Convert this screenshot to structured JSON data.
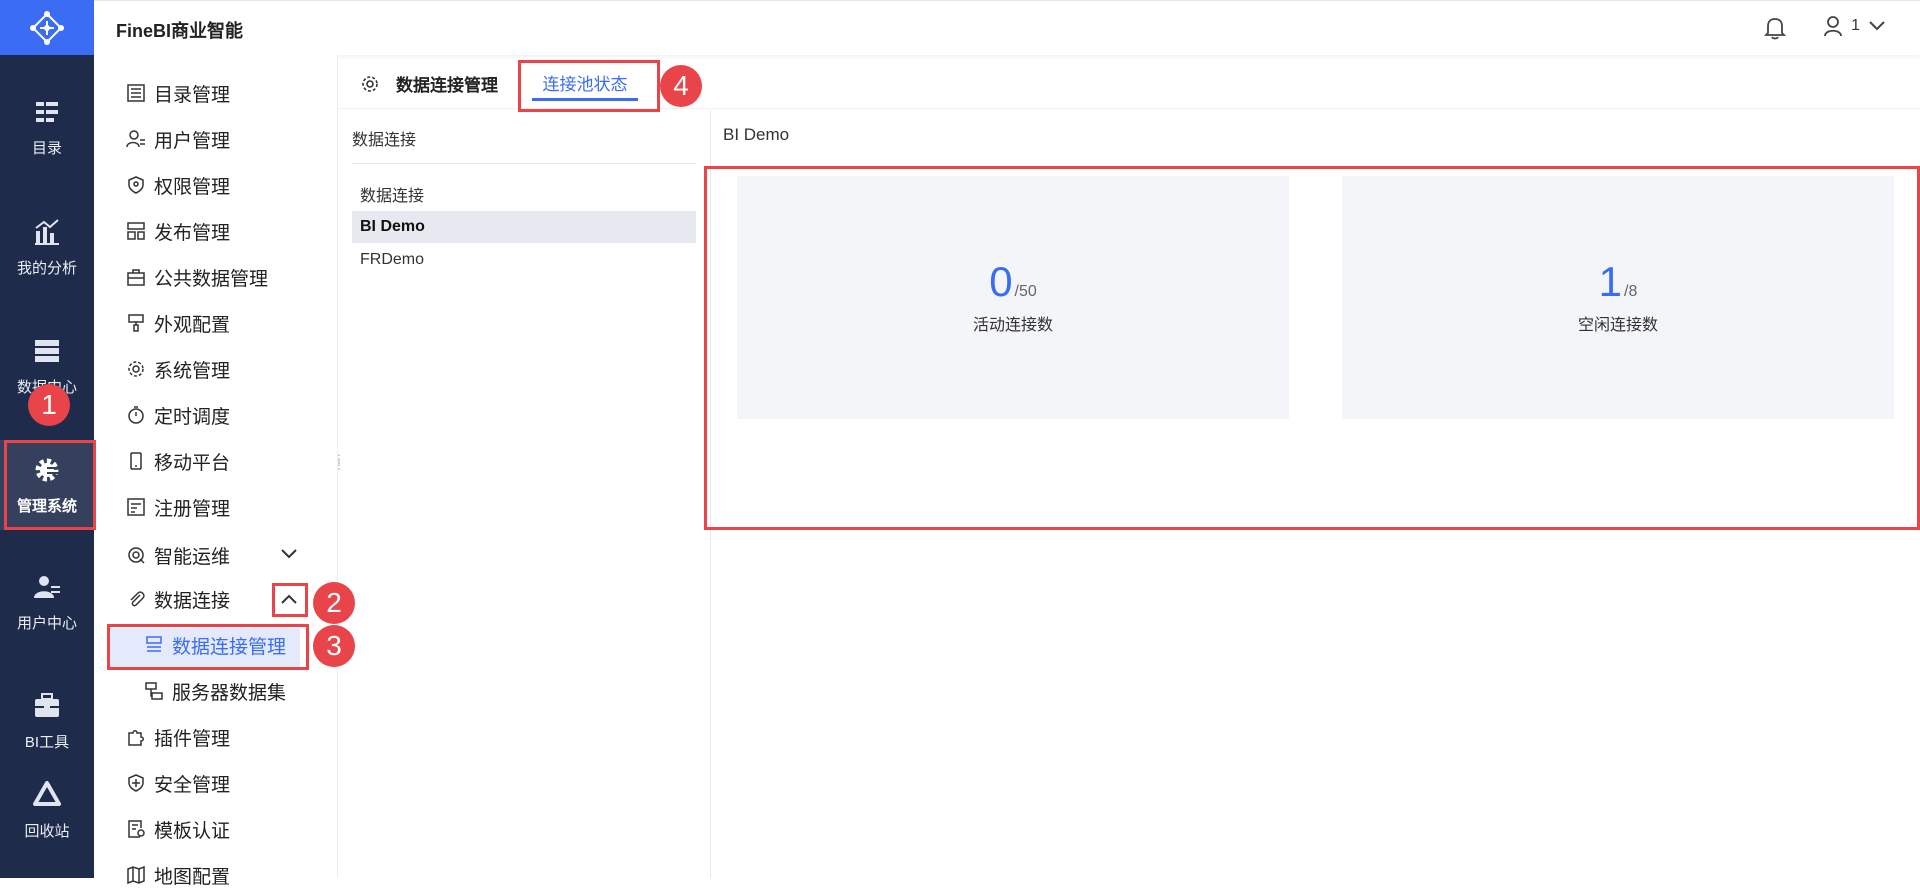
{
  "app": {
    "title": "FineBI商业智能"
  },
  "topbar": {
    "user_label": "1"
  },
  "leftnav": [
    {
      "label": "目录",
      "icon": "directory-icon"
    },
    {
      "label": "我的分析",
      "icon": "analysis-icon"
    },
    {
      "label": "数据中心",
      "icon": "data-center-icon"
    },
    {
      "label": "管理系统",
      "icon": "admin-gear-icon"
    },
    {
      "label": "用户中心",
      "icon": "user-center-icon"
    },
    {
      "label": "BI工具",
      "icon": "toolbox-icon"
    },
    {
      "label": "回收站",
      "icon": "recycle-icon"
    }
  ],
  "sidemenu": {
    "items": [
      "目录管理",
      "用户管理",
      "权限管理",
      "发布管理",
      "公共数据管理",
      "外观配置",
      "系统管理",
      "定时调度",
      "移动平台",
      "注册管理",
      "智能运维",
      "数据连接",
      "数据连接管理",
      "服务器数据集",
      "插件管理",
      "安全管理",
      "模板认证",
      "地图配置"
    ]
  },
  "tabs": {
    "settings_label": "数据连接管理",
    "pool_label": "连接池状态"
  },
  "connections": {
    "title": "数据连接",
    "items": [
      "数据连接",
      "BI Demo",
      "FRDemo"
    ]
  },
  "detail": {
    "title": "BI Demo",
    "active": {
      "value": "0",
      "max": "/50",
      "caption": "活动连接数"
    },
    "idle": {
      "value": "1",
      "max": "/8",
      "caption": "空闲连接数"
    }
  },
  "annotations": [
    "1",
    "2",
    "3",
    "4"
  ],
  "colors": {
    "accent": "#3b6df4",
    "nav_bg": "#1e2b4a",
    "highlight_red": "#e8444a"
  }
}
